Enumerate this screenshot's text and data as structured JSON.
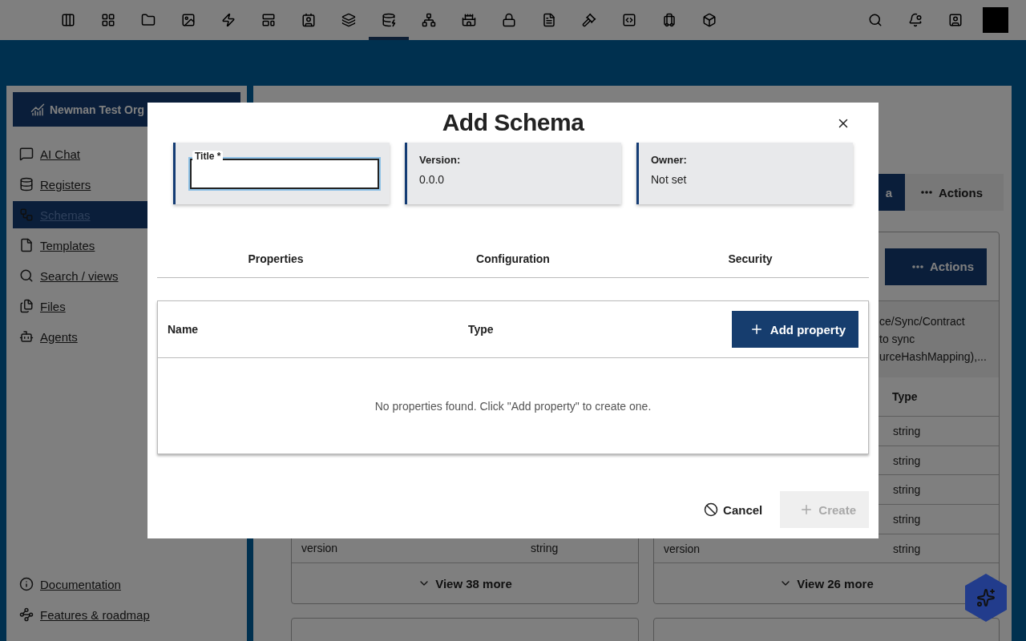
{
  "top_nav": {
    "items": [
      {
        "selected": false
      },
      {
        "selected": false
      },
      {
        "selected": false
      },
      {
        "selected": false
      },
      {
        "selected": false
      },
      {
        "selected": false
      },
      {
        "selected": false
      },
      {
        "selected": false
      },
      {
        "selected": true
      },
      {
        "selected": false
      },
      {
        "selected": false
      },
      {
        "selected": false
      },
      {
        "selected": false
      },
      {
        "selected": false
      },
      {
        "selected": false
      },
      {
        "selected": false
      },
      {
        "selected": false
      }
    ]
  },
  "sidebar": {
    "org": "Newman Test Org",
    "items": [
      {
        "label": "AI Chat",
        "selected": false
      },
      {
        "label": "Registers",
        "selected": false
      },
      {
        "label": "Schemas",
        "selected": true
      },
      {
        "label": "Templates",
        "selected": false
      },
      {
        "label": "Search / views",
        "selected": false
      },
      {
        "label": "Files",
        "selected": false
      },
      {
        "label": "Agents",
        "selected": false
      }
    ],
    "footer_items": [
      "Documentation",
      "Features & roadmap"
    ]
  },
  "main": {
    "toolbar": {
      "primary_fragment": "a",
      "actions": "Actions"
    },
    "cards": [
      {
        "rows": [
          {
            "name": "version",
            "type": "string"
          }
        ],
        "view_more": "View 38 more"
      },
      {
        "actions": "Actions",
        "description_lines": [
          "ce/Sync/Contract",
          "to sync",
          "urceHashMapping),..."
        ],
        "type_header": "Type",
        "rows": [
          {
            "type": "string"
          },
          {
            "type": "string"
          },
          {
            "type": "string"
          },
          {
            "type": "string"
          },
          {
            "name": "version",
            "type": "string"
          }
        ],
        "view_more": "View 26 more"
      }
    ]
  },
  "dialog": {
    "title": "Add Schema",
    "fields": [
      {
        "kind": "input",
        "label": "Title *",
        "focused": true
      },
      {
        "kind": "info",
        "label": "Version:",
        "value": "0.0.0"
      },
      {
        "kind": "info",
        "label": "Owner:",
        "value": "Not set"
      }
    ],
    "tabs": [
      "Properties",
      "Configuration",
      "Security"
    ],
    "table": {
      "columns": [
        "Name",
        "Type"
      ],
      "add_button": "Add property",
      "empty_message": "No properties found. Click \"Add property\" to create one."
    },
    "buttons": [
      {
        "kind": "text",
        "label": "Cancel",
        "disabled": false
      },
      {
        "kind": "primary",
        "label": "Create",
        "disabled": true
      }
    ]
  }
}
